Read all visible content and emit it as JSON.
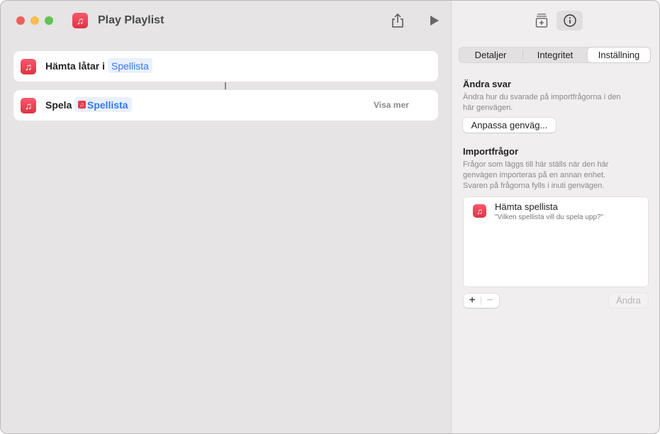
{
  "window": {
    "title": "Play Playlist"
  },
  "toolbar": {
    "share_icon": "share-icon",
    "run_icon": "play-icon"
  },
  "actions": [
    {
      "label": "Hämta låtar i",
      "token": "Spellista"
    },
    {
      "label": "Spela",
      "token": "Spellista",
      "more": "Visa mer"
    }
  ],
  "inspector": {
    "tabs": [
      "Detaljer",
      "Integritet",
      "Inställning"
    ],
    "selected_tab": "Inställning",
    "change_answers": {
      "heading": "Ändra svar",
      "desc1": "Ändra hur du svarade på importfrågorna i den",
      "desc2": "här genvägen.",
      "button": "Anpassa genväg..."
    },
    "import_questions": {
      "heading": "Importfrågor",
      "desc1": "Frågor som läggs till här ställs när den här",
      "desc2": "genvägen importeras på en annan enhet.",
      "desc3": "Svaren på frågorna fylls i inuti genvägen.",
      "items": [
        {
          "title": "Hämta spellista",
          "question": "\"Vilken spellista vill du spela upp?\""
        }
      ],
      "add": "+",
      "remove": "−",
      "edit": "Ändra"
    }
  }
}
